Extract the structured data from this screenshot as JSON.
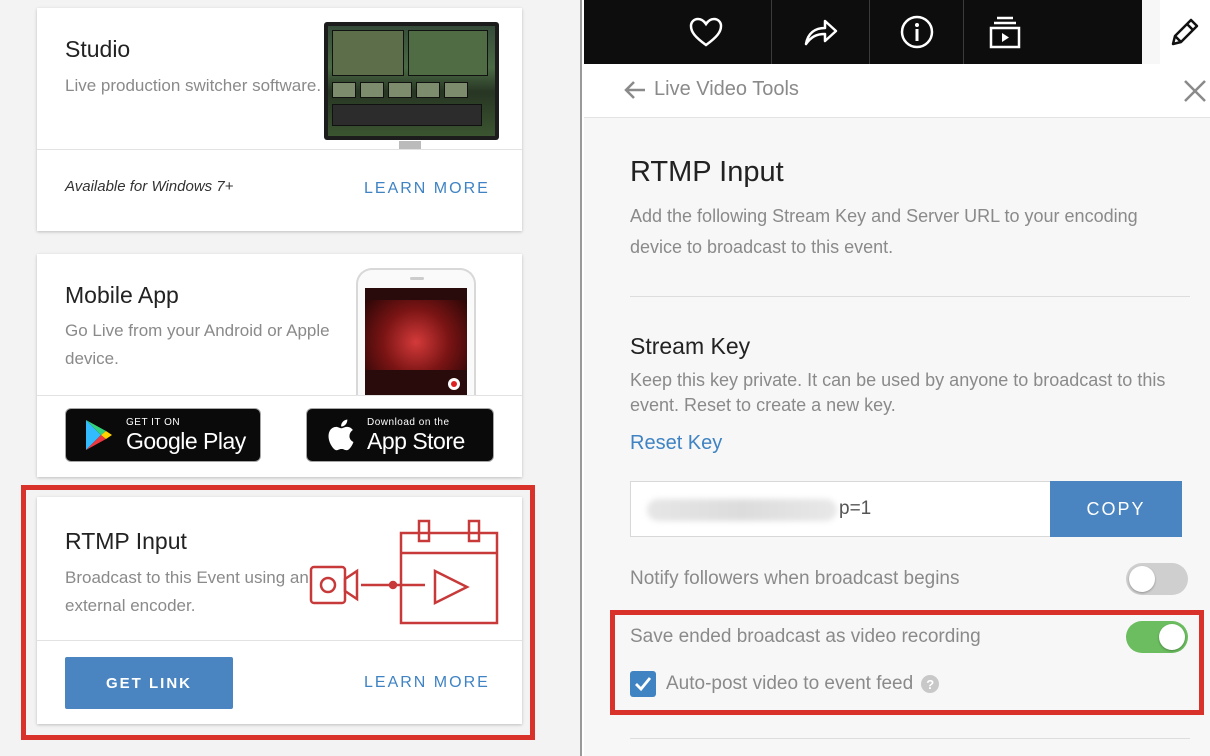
{
  "colors": {
    "accent": "#4a85c1",
    "link": "#3f83c3",
    "highlight": "#d9322a",
    "toggle_on": "#6bbd5f"
  },
  "left": {
    "studio": {
      "title": "Studio",
      "description": "Live production switcher software.",
      "availability": "Available for Windows 7+",
      "learn_more": "LEARN MORE"
    },
    "mobile": {
      "title": "Mobile App",
      "description": "Go Live from your Android or Apple device.",
      "google_play": {
        "small": "GET IT ON",
        "big": "Google Play"
      },
      "app_store": {
        "small": "Download on the",
        "big": "App Store"
      }
    },
    "rtmp": {
      "title": "RTMP Input",
      "description": "Broadcast to this Event using an external encoder.",
      "get_link": "GET LINK",
      "learn_more": "LEARN MORE"
    }
  },
  "right": {
    "toolbar": {
      "icons": [
        "heart-icon",
        "share-icon",
        "info-icon",
        "playlist-icon",
        "pencil-icon"
      ]
    },
    "header": {
      "back_label": "Live Video Tools"
    },
    "title": "RTMP Input",
    "description": "Add the following Stream Key and Server URL to your encoding device to broadcast to this event.",
    "stream_key": {
      "title": "Stream Key",
      "description": "Keep this key private. It can be used by anyone to broadcast to this event. Reset to create a new key.",
      "reset_label": "Reset Key",
      "value_suffix": "p=1",
      "copy_label": "COPY"
    },
    "notify": {
      "label": "Notify followers when broadcast begins",
      "on": false
    },
    "save_recording": {
      "label": "Save ended broadcast as video recording",
      "on": true
    },
    "auto_post": {
      "label": "Auto-post video to event feed",
      "checked": true,
      "help": "?"
    }
  }
}
